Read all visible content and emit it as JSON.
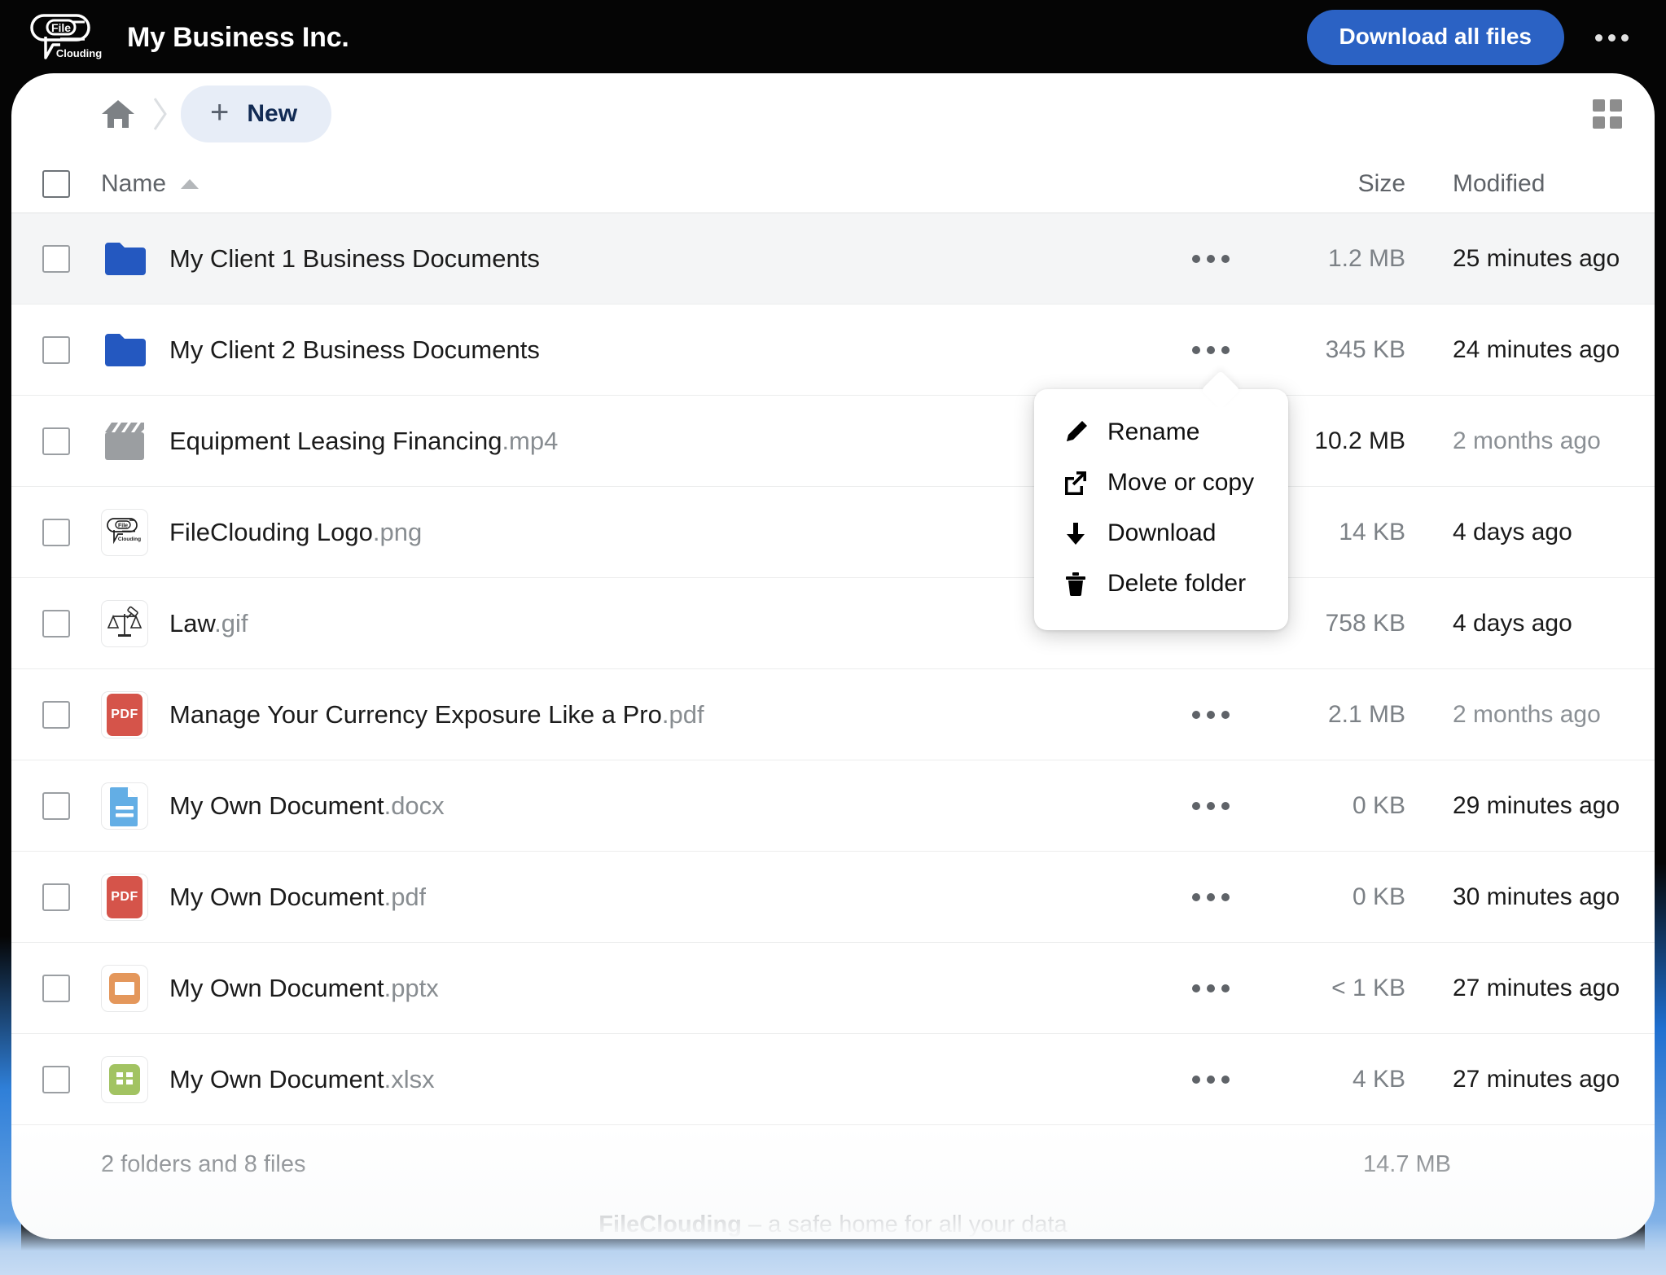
{
  "topbar": {
    "brand_title": "My Business Inc.",
    "logo_name": "fileclouding-logo",
    "download_all_label": "Download all files",
    "overflow_icon": "more-horizontal-icon"
  },
  "toolbar": {
    "home_icon": "home-icon",
    "separator_icon": "chevron-right-icon",
    "new_button": {
      "label": "New",
      "icon": "plus-icon"
    },
    "view_toggle_icon": "grid-view-icon"
  },
  "table": {
    "headers": {
      "name": "Name",
      "size": "Size",
      "modified": "Modified"
    },
    "sort": {
      "column": "Name",
      "direction": "asc",
      "icon": "caret-up-icon"
    },
    "rows": [
      {
        "icon": "folder-icon",
        "name": "My Client 1 Business Documents",
        "ext": "",
        "size": "1.2 MB",
        "size_dark": false,
        "modified": "25 minutes ago",
        "modified_muted": false,
        "selected": true
      },
      {
        "icon": "folder-icon",
        "name": "My Client 2 Business Documents",
        "ext": "",
        "size": "345 KB",
        "size_dark": false,
        "modified": "24 minutes ago",
        "modified_muted": false,
        "selected": false
      },
      {
        "icon": "video-clapperboard-icon",
        "name": "Equipment Leasing Financing",
        "ext": ".mp4",
        "size": "10.2 MB",
        "size_dark": true,
        "modified": "2 months ago",
        "modified_muted": true,
        "selected": false
      },
      {
        "icon": "image-thumbnail-fileclouding-icon",
        "name": "FileClouding Logo",
        "ext": ".png",
        "size": "14 KB",
        "size_dark": false,
        "modified": "4 days ago",
        "modified_muted": false,
        "selected": false
      },
      {
        "icon": "image-thumbnail-law-icon",
        "name": "Law",
        "ext": ".gif",
        "size": "758 KB",
        "size_dark": false,
        "modified": "4 days ago",
        "modified_muted": false,
        "selected": false
      },
      {
        "icon": "pdf-icon",
        "name": "Manage Your Currency Exposure Like a Pro",
        "ext": ".pdf",
        "size": "2.1 MB",
        "size_dark": false,
        "modified": "2 months ago",
        "modified_muted": true,
        "selected": false
      },
      {
        "icon": "word-document-icon",
        "name": "My Own Document",
        "ext": ".docx",
        "size": "0 KB",
        "size_dark": false,
        "modified": "29 minutes ago",
        "modified_muted": false,
        "selected": false
      },
      {
        "icon": "pdf-icon",
        "name": "My Own Document",
        "ext": ".pdf",
        "size": "0 KB",
        "size_dark": false,
        "modified": "30 minutes ago",
        "modified_muted": false,
        "selected": false
      },
      {
        "icon": "powerpoint-icon",
        "name": "My Own Document",
        "ext": ".pptx",
        "size": "< 1 KB",
        "size_dark": false,
        "modified": "27 minutes ago",
        "modified_muted": false,
        "selected": false
      },
      {
        "icon": "excel-icon",
        "name": "My Own Document",
        "ext": ".xlsx",
        "size": "4 KB",
        "size_dark": false,
        "modified": "27 minutes ago",
        "modified_muted": false,
        "selected": false
      }
    ],
    "row_kebab_icon": "more-horizontal-icon"
  },
  "context_menu": {
    "for_row": "My Client 1 Business Documents",
    "items": [
      {
        "label": "Rename",
        "icon": "pencil-icon"
      },
      {
        "label": "Move or copy",
        "icon": "external-link-icon"
      },
      {
        "label": "Download",
        "icon": "download-arrow-icon"
      },
      {
        "label": "Delete folder",
        "icon": "trash-icon"
      }
    ]
  },
  "footer": {
    "counts": "2 folders and 8 files",
    "total_size": "14.7 MB",
    "tagline_brand": "FileClouding",
    "tagline_rest": " – a safe home for all your data"
  },
  "colors": {
    "accent_blue": "#2b62c4",
    "folder_blue": "#2458c0",
    "pdf_red": "#d5544a",
    "docx_blue": "#63aee5",
    "pptx_orange": "#e4975b",
    "xlsx_green": "#a2c362",
    "new_button_bg": "#e7edf7",
    "new_button_text": "#122b54",
    "selected_row_bg": "#f4f5f6"
  }
}
